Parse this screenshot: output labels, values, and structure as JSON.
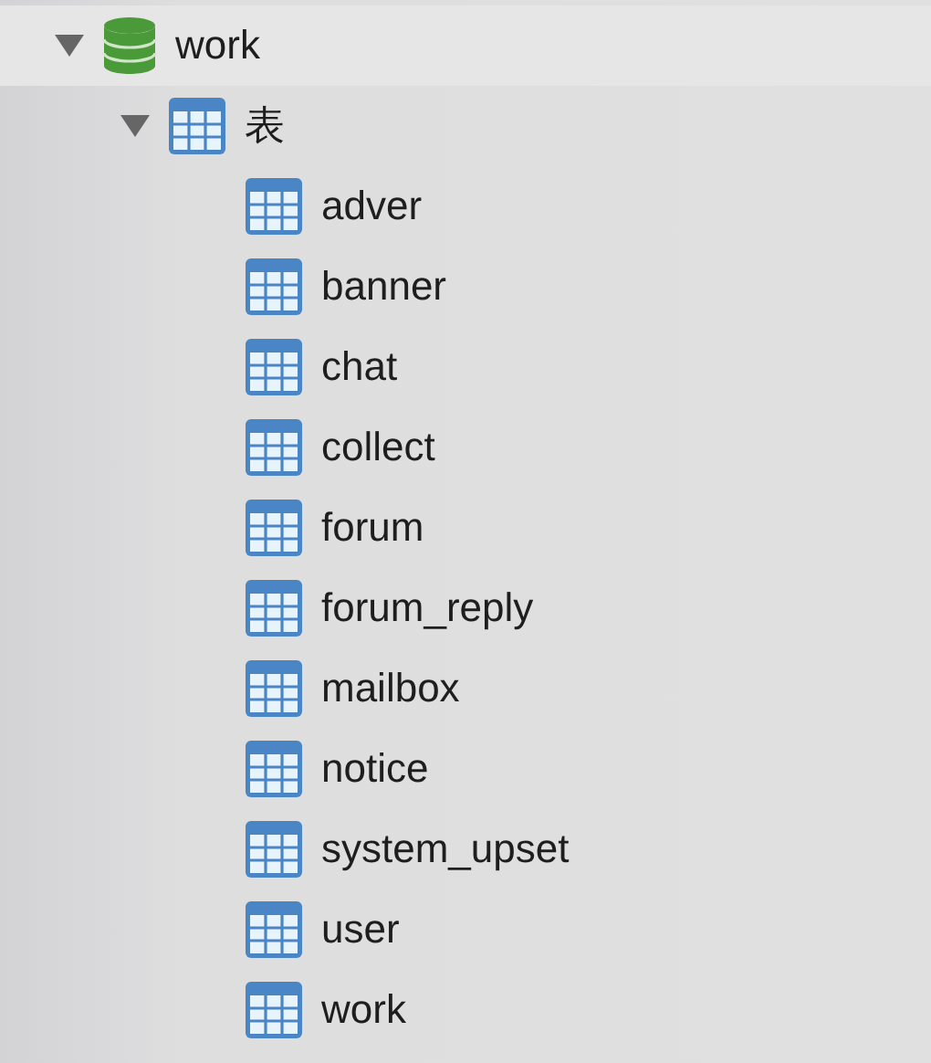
{
  "tree": [
    {
      "label": "work",
      "kind": "database",
      "expanded": true,
      "selected": true,
      "children": [
        {
          "label": "表",
          "kind": "folder",
          "expanded": true,
          "selected": false,
          "children": [
            {
              "label": "adver",
              "kind": "table",
              "selected": false
            },
            {
              "label": "banner",
              "kind": "table",
              "selected": false
            },
            {
              "label": "chat",
              "kind": "table",
              "selected": false
            },
            {
              "label": "collect",
              "kind": "table",
              "selected": false
            },
            {
              "label": "forum",
              "kind": "table",
              "selected": false
            },
            {
              "label": "forum_reply",
              "kind": "table",
              "selected": false
            },
            {
              "label": "mailbox",
              "kind": "table",
              "selected": false
            },
            {
              "label": "notice",
              "kind": "table",
              "selected": false
            },
            {
              "label": "system_upset",
              "kind": "table",
              "selected": false
            },
            {
              "label": "user",
              "kind": "table",
              "selected": false
            },
            {
              "label": "work",
              "kind": "table",
              "selected": false
            }
          ]
        }
      ]
    }
  ]
}
